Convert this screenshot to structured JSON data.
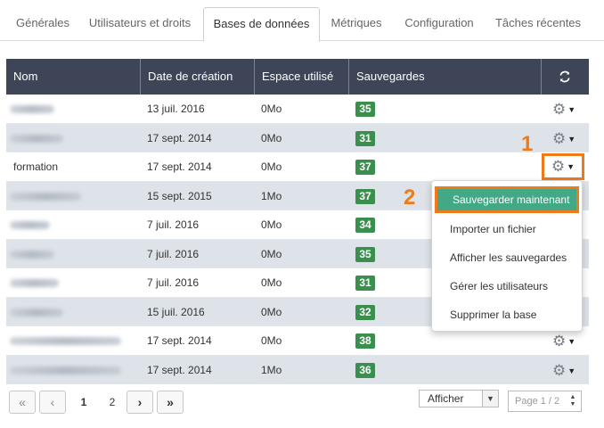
{
  "tabs": [
    {
      "label": "Générales"
    },
    {
      "label": "Utilisateurs et droits"
    },
    {
      "label": "Bases de données",
      "active": true
    },
    {
      "label": "Métriques"
    },
    {
      "label": "Configuration"
    },
    {
      "label": "Tâches récentes"
    }
  ],
  "table": {
    "headers": {
      "name": "Nom",
      "created": "Date de création",
      "space": "Espace utilisé",
      "backups": "Sauvegardes",
      "refresh_icon": "refresh-icon"
    },
    "rows": [
      {
        "name": "",
        "name_blurred": true,
        "created": "13 juil. 2016",
        "space": "0Mo",
        "backups": "35"
      },
      {
        "name": "",
        "name_blurred": true,
        "created": "17 sept. 2014",
        "space": "0Mo",
        "backups": "31"
      },
      {
        "name": "formation",
        "name_blurred": false,
        "created": "17 sept. 2014",
        "space": "0Mo",
        "backups": "37"
      },
      {
        "name": "",
        "name_blurred": true,
        "created": "15 sept. 2015",
        "space": "1Mo",
        "backups": "37"
      },
      {
        "name": "",
        "name_blurred": true,
        "created": "7 juil. 2016",
        "space": "0Mo",
        "backups": "34"
      },
      {
        "name": "",
        "name_blurred": true,
        "created": "7 juil. 2016",
        "space": "0Mo",
        "backups": "35"
      },
      {
        "name": "",
        "name_blurred": true,
        "created": "7 juil. 2016",
        "space": "0Mo",
        "backups": "31"
      },
      {
        "name": "",
        "name_blurred": true,
        "created": "15 juil. 2016",
        "space": "0Mo",
        "backups": "32"
      },
      {
        "name": "",
        "name_blurred": true,
        "created": "17 sept. 2014",
        "space": "0Mo",
        "backups": "38"
      },
      {
        "name": "",
        "name_blurred": true,
        "created": "17 sept. 2014",
        "space": "1Mo",
        "backups": "36"
      }
    ]
  },
  "annotations": {
    "step1": "1",
    "step2": "2"
  },
  "menu": {
    "items": [
      {
        "label": "Sauvegarder maintenant"
      },
      {
        "label": "Importer un fichier"
      },
      {
        "label": "Afficher les sauvegardes"
      },
      {
        "label": "Gérer les utilisateurs"
      },
      {
        "label": "Supprimer la base"
      }
    ]
  },
  "pagination": {
    "first_icon": "«",
    "prev_icon": "‹",
    "pages": [
      "1",
      "2"
    ],
    "current": "1",
    "next_icon": "›",
    "last_icon": "»",
    "show_select": "Afficher",
    "page_indicator": "Page 1 / 2"
  },
  "colors": {
    "header_bg": "#3d4556",
    "badge": "#3a8f4e",
    "highlight": "#ef7a1a",
    "menu_primary": "#43a886"
  }
}
